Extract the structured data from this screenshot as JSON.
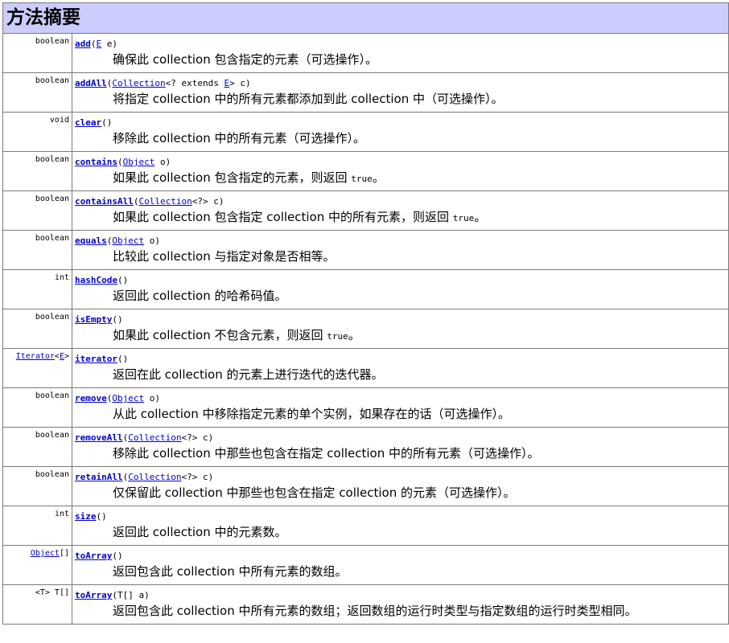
{
  "heading": "方法摘要",
  "methods": [
    {
      "return_type": "boolean",
      "name": "add",
      "params": [
        {
          "text": "("
        },
        {
          "text": "E",
          "link": true
        },
        {
          "text": "  e)"
        }
      ],
      "description": [
        {
          "text": "确保此 collection 包含指定的元素（可选操作）。"
        }
      ]
    },
    {
      "return_type": "boolean",
      "name": "addAll",
      "params": [
        {
          "text": "("
        },
        {
          "text": "Collection",
          "link": true
        },
        {
          "text": "<? extends "
        },
        {
          "text": "E",
          "link": true
        },
        {
          "text": ">  c)"
        }
      ],
      "description": [
        {
          "text": "将指定 collection 中的所有元素都添加到此 collection 中（可选操作）。"
        }
      ]
    },
    {
      "return_type": "void",
      "name": "clear",
      "params": [
        {
          "text": "()"
        }
      ],
      "description": [
        {
          "text": "移除此 collection 中的所有元素（可选操作）。"
        }
      ]
    },
    {
      "return_type": "boolean",
      "name": "contains",
      "params": [
        {
          "text": "("
        },
        {
          "text": "Object",
          "link": true
        },
        {
          "text": "  o)"
        }
      ],
      "description": [
        {
          "text": "如果此 collection 包含指定的元素，则返回 "
        },
        {
          "text": "true",
          "code": true
        },
        {
          "text": "。"
        }
      ]
    },
    {
      "return_type": "boolean",
      "name": "containsAll",
      "params": [
        {
          "text": "("
        },
        {
          "text": "Collection",
          "link": true
        },
        {
          "text": "<?>  c)"
        }
      ],
      "description": [
        {
          "text": "如果此 collection 包含指定 collection 中的所有元素，则返回 "
        },
        {
          "text": "true",
          "code": true
        },
        {
          "text": "。"
        }
      ]
    },
    {
      "return_type": "boolean",
      "name": "equals",
      "params": [
        {
          "text": "("
        },
        {
          "text": "Object",
          "link": true
        },
        {
          "text": "  o)"
        }
      ],
      "description": [
        {
          "text": "比较此 collection 与指定对象是否相等。"
        }
      ]
    },
    {
      "return_type": "int",
      "name": "hashCode",
      "params": [
        {
          "text": "()"
        }
      ],
      "description": [
        {
          "text": "返回此 collection 的哈希码值。"
        }
      ]
    },
    {
      "return_type": "boolean",
      "name": "isEmpty",
      "params": [
        {
          "text": "()"
        }
      ],
      "description": [
        {
          "text": "如果此 collection 不包含元素，则返回 "
        },
        {
          "text": "true",
          "code": true
        },
        {
          "text": "。"
        }
      ]
    },
    {
      "return_type_parts": [
        {
          "text": "Iterator",
          "link": true
        },
        {
          "text": "<"
        },
        {
          "text": "E",
          "link": true
        },
        {
          "text": ">"
        }
      ],
      "name": "iterator",
      "params": [
        {
          "text": "()"
        }
      ],
      "description": [
        {
          "text": "返回在此 collection 的元素上进行迭代的迭代器。"
        }
      ]
    },
    {
      "return_type": "boolean",
      "name": "remove",
      "params": [
        {
          "text": "("
        },
        {
          "text": "Object",
          "link": true
        },
        {
          "text": "  o)"
        }
      ],
      "description": [
        {
          "text": "从此 collection 中移除指定元素的单个实例，如果存在的话（可选操作）。"
        }
      ]
    },
    {
      "return_type": "boolean",
      "name": "removeAll",
      "params": [
        {
          "text": "("
        },
        {
          "text": "Collection",
          "link": true
        },
        {
          "text": "<?>  c)"
        }
      ],
      "description": [
        {
          "text": "移除此 collection 中那些也包含在指定 collection 中的所有元素（可选操作）。"
        }
      ]
    },
    {
      "return_type": "boolean",
      "name": "retainAll",
      "params": [
        {
          "text": "("
        },
        {
          "text": "Collection",
          "link": true
        },
        {
          "text": "<?>  c)"
        }
      ],
      "description": [
        {
          "text": "仅保留此 collection 中那些也包含在指定 collection 的元素（可选操作）。"
        }
      ]
    },
    {
      "return_type": "int",
      "name": "size",
      "params": [
        {
          "text": "()"
        }
      ],
      "description": [
        {
          "text": "返回此 collection 中的元素数。"
        }
      ]
    },
    {
      "return_type_parts": [
        {
          "text": "Object",
          "link": true
        },
        {
          "text": "[]"
        }
      ],
      "name": "toArray",
      "params": [
        {
          "text": "()"
        }
      ],
      "description": [
        {
          "text": "返回包含此 collection 中所有元素的数组。"
        }
      ]
    },
    {
      "return_type": "<T> T[]",
      "name": "toArray",
      "params": [
        {
          "text": "(T[]  a)"
        }
      ],
      "description": [
        {
          "text": "返回包含此 collection 中所有元素的数组；返回数组的运行时类型与指定数组的运行时类型相同。"
        }
      ]
    }
  ],
  "colors": {
    "header_bg": "#ccccff",
    "link": "#0000cc",
    "border": "#7a7a7a"
  }
}
